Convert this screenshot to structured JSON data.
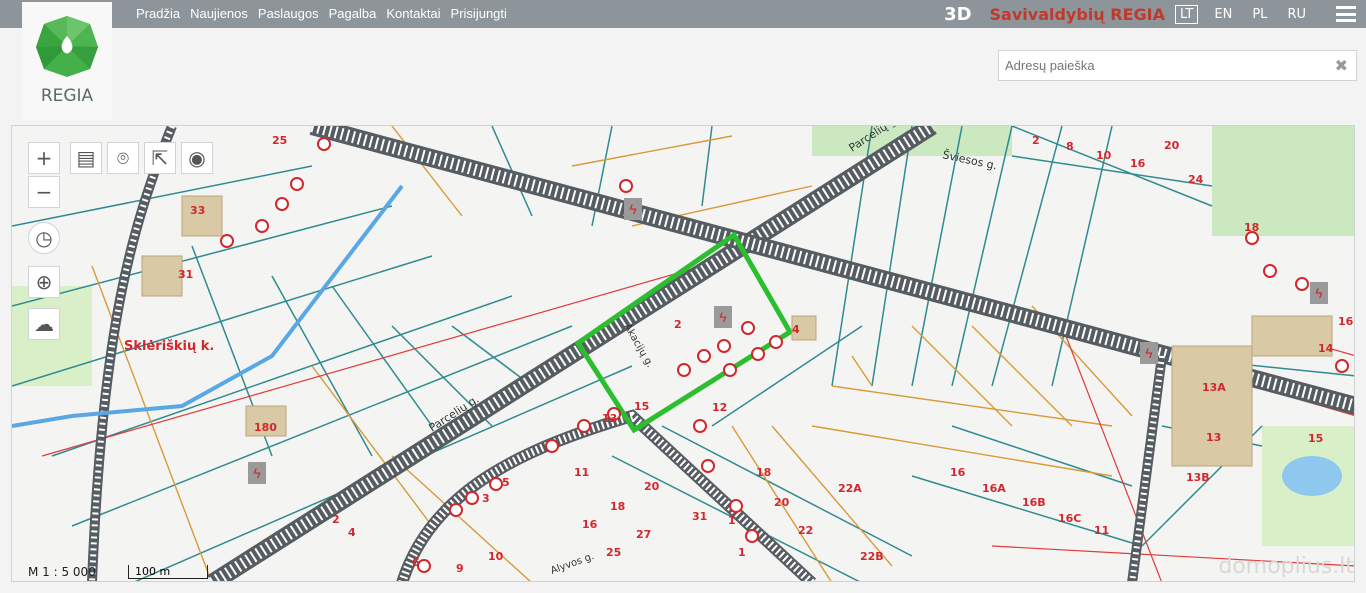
{
  "nav": [
    "Pradžia",
    "Naujienos",
    "Paslaugos",
    "Pagalba",
    "Kontaktai",
    "Prisijungti"
  ],
  "header": {
    "btn_3d": "3D",
    "brand": "Savivaldybių REGIA",
    "languages": [
      "LT",
      "EN",
      "PL",
      "RU"
    ],
    "active_language": "LT",
    "logo_text": "REGIA"
  },
  "search": {
    "placeholder": "Adresų paieška",
    "value": ""
  },
  "map": {
    "scale_text": "M 1 : 5 000",
    "scalebar_text": "100 m",
    "watermark": "domoplius.lt",
    "village_label": "Sklėriškių k.",
    "street_labels": [
      "Parcelių g.",
      "Parcelių g.",
      "Šviesos g.",
      "Akacijų g.",
      "Alyvos g."
    ],
    "parcel_numbers": [
      "25",
      "33",
      "31",
      "180",
      "2",
      "4",
      "15",
      "12",
      "13",
      "11",
      "18",
      "20",
      "31",
      "16",
      "27",
      "25",
      "10",
      "9",
      "6",
      "4",
      "2",
      "3",
      "5",
      "1",
      "22",
      "22A",
      "22B",
      "18",
      "20",
      "1",
      "2",
      "8",
      "10",
      "16",
      "20",
      "24",
      "18",
      "16",
      "14",
      "13A",
      "13",
      "13B",
      "15",
      "16",
      "16A",
      "16B",
      "16C",
      "11"
    ],
    "colors": {
      "highlight": "#2bbf2f",
      "parcel_teal": "#2f8b8f",
      "parcel_orange": "#d99a3a",
      "lines_red": "#e03a3a",
      "rail_dark": "#555c62",
      "water_blue": "#5aa7e6"
    }
  }
}
